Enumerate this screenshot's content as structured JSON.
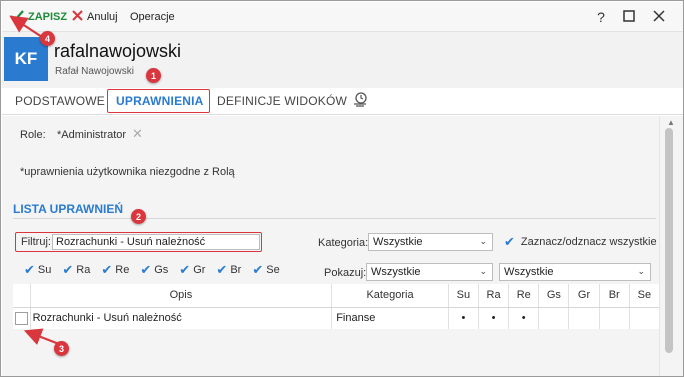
{
  "toolbar": {
    "save_label": "ZAPISZ",
    "cancel_label": "Anuluj",
    "ops_label": "Operacje",
    "help_label": "?"
  },
  "header": {
    "avatar_initials": "KF",
    "login": "rafalnawojowski",
    "full_name": "Rafał Nawojowski"
  },
  "tabs": [
    {
      "label": "PODSTAWOWE",
      "active": false
    },
    {
      "label": "UPRAWNIENIA",
      "active": true
    },
    {
      "label": "DEFINICJE WIDOKÓW",
      "active": false
    }
  ],
  "roles": {
    "label": "Role:",
    "value": "*Administrator",
    "note": "*uprawnienia użytkownika niezgodne z Rolą"
  },
  "list": {
    "title": "LISTA UPRAWNIEŃ",
    "filter_label": "Filtruj:",
    "filter_value": "Rozrachunki - Usuń należność",
    "category_label": "Kategoria:",
    "category_value": "Wszystkie",
    "toggle_all_label": "Zaznacz/odznacz wszystkie",
    "show_label": "Pokazuj:",
    "show_value": "Wszystkie",
    "show_value_2": "Wszystkie",
    "operations": [
      "Su",
      "Ra",
      "Re",
      "Gs",
      "Gr",
      "Br",
      "Se"
    ]
  },
  "table": {
    "columns": [
      "Opis",
      "Kategoria",
      "Su",
      "Ra",
      "Re",
      "Gs",
      "Gr",
      "Br",
      "Se"
    ],
    "rows": [
      {
        "opis": "Rozrachunki - Usuń należność",
        "kategoria": "Finanse",
        "su": "•",
        "ra": "•",
        "re": "•",
        "gs": "",
        "gr": "",
        "br": "",
        "se": ""
      }
    ]
  },
  "annotations": [
    "1",
    "2",
    "3",
    "4"
  ],
  "colors": {
    "accent": "#2a7bd0",
    "save": "#1f8a3a",
    "highlight": "#d9363e"
  }
}
